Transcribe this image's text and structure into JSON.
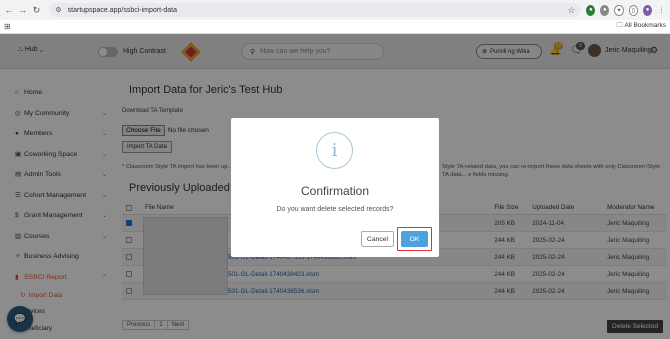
{
  "browser": {
    "url": "startupspace.app/ssbci-import-data",
    "bookmarks_label": "All Bookmarks",
    "nav_icons": [
      "back-icon",
      "forward-icon",
      "reload-icon"
    ]
  },
  "header": {
    "hub_label": "Hub",
    "contrast_label": "High Contrast",
    "search_placeholder": "How can we help you?",
    "language_label": "Pumili ng Wika",
    "notification_count": "17",
    "message_count": "0",
    "user_name": "Jeric Maquiling",
    "colors": {
      "notification_badge": "#e8a23a",
      "message_badge": "#555555"
    }
  },
  "sidebar": {
    "items": [
      {
        "label": "Home",
        "icon": "home-icon"
      },
      {
        "label": "My Community",
        "icon": "globe-icon"
      },
      {
        "label": "Members",
        "icon": "user-icon"
      },
      {
        "label": "Coworking Space",
        "icon": "building-icon"
      },
      {
        "label": "Admin Tools",
        "icon": "tools-icon"
      },
      {
        "label": "Cohort Management",
        "icon": "list-icon"
      },
      {
        "label": "Grant Management",
        "icon": "dollar-icon"
      },
      {
        "label": "Courses",
        "icon": "book-icon"
      },
      {
        "label": "Business Advising",
        "icon": "handshake-icon"
      },
      {
        "label": "SSBCI Report",
        "icon": "file-icon"
      }
    ],
    "sub_items": [
      "Import Data",
      "Services",
      "Beneficiary"
    ]
  },
  "main": {
    "title": "Import Data for Jeric's Test Hub",
    "download_template": "Download TA Template",
    "choose_file": "Choose File",
    "no_file": "No file chosen",
    "import_button": "Import TA Data",
    "note_left": "* Classroom Style TA import has been up... TA data to update the information.",
    "note_right": "Style TA-related data, you can re-import these data sheets with only Classroom-Style TA data... e fields missing.",
    "section_title": "Previously Uploaded",
    "table": {
      "headers": [
        "File Name",
        "File Size",
        "Uploaded Date",
        "Moderator Name"
      ],
      "rows": [
        {
          "file": "",
          "size": "205 KB",
          "date": "2024-11-04",
          "moderator": "Jeric Maquiling",
          "checked": true
        },
        {
          "file": "",
          "size": "244 KB",
          "date": "2025-02-24",
          "moderator": "Jeric Maquiling",
          "checked": false
        },
        {
          "file": "501-GL-Detail-1740437353-1740438360.xlsm",
          "size": "244 KB",
          "date": "2025-02-24",
          "moderator": "Jeric Maquiling",
          "checked": false
        },
        {
          "file": "501-GL-Detail-1740438423.xlsm",
          "size": "244 KB",
          "date": "2025-02-24",
          "moderator": "Jeric Maquiling",
          "checked": false
        },
        {
          "file": "501-GL-Detail-1740438536.xlsm",
          "size": "244 KB",
          "date": "2025-02-24",
          "moderator": "Jeric Maquiling",
          "checked": false
        }
      ]
    },
    "pager": {
      "previous": "Previous",
      "page": "1",
      "next": "Next"
    },
    "delete_button": "Delete Selected"
  },
  "modal": {
    "icon": "info-icon",
    "title": "Confirmation",
    "message": "Do you want delete selected records?",
    "cancel": "Cancel",
    "ok": "OK",
    "colors": {
      "ok": "#4aa3df",
      "highlight": "#dd3333"
    }
  }
}
